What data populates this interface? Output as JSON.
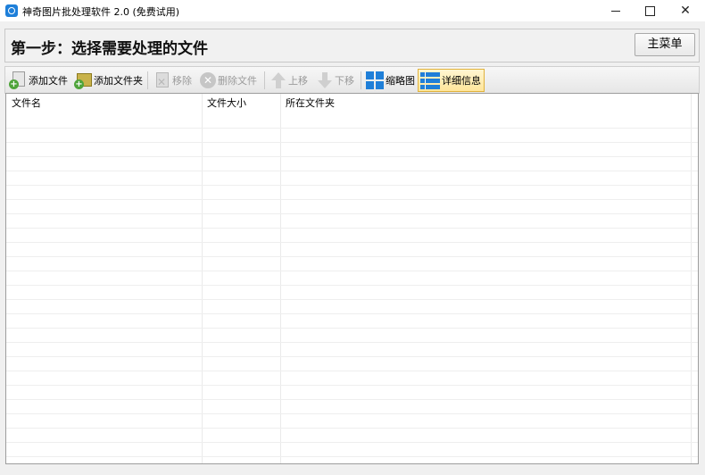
{
  "window": {
    "title": "神奇图片批处理软件 2.0 (免费试用)"
  },
  "step": {
    "title": "第一步：选择需要处理的文件",
    "main_menu_label": "主菜单"
  },
  "toolbar": {
    "add_file": "添加文件",
    "add_folder": "添加文件夹",
    "remove": "移除",
    "delete_file": "删除文件",
    "move_up": "上移",
    "move_down": "下移",
    "thumbnail": "缩略图",
    "details": "详细信息"
  },
  "table": {
    "columns": [
      "文件名",
      "文件大小",
      "所在文件夹"
    ],
    "rows": []
  },
  "colors": {
    "accent": "#1f7fd8",
    "active_bg": "#ffe59a",
    "active_border": "#e0b23c"
  }
}
